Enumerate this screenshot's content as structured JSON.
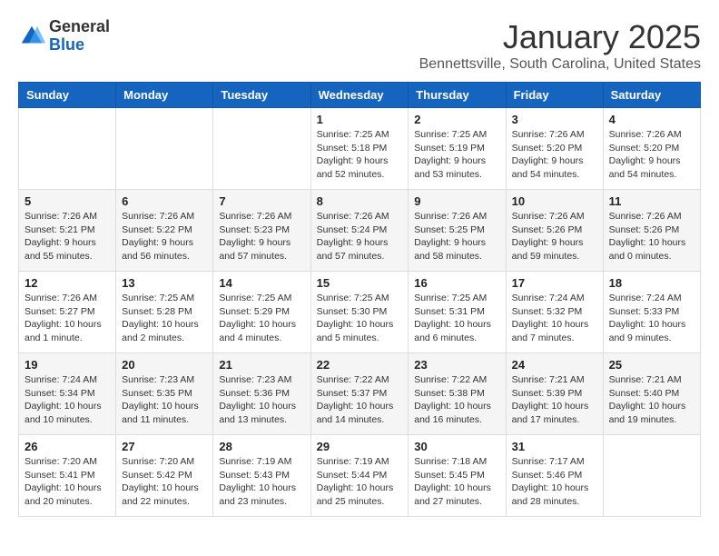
{
  "logo": {
    "general": "General",
    "blue": "Blue"
  },
  "header": {
    "month": "January 2025",
    "location": "Bennettsville, South Carolina, United States"
  },
  "days_of_week": [
    "Sunday",
    "Monday",
    "Tuesday",
    "Wednesday",
    "Thursday",
    "Friday",
    "Saturday"
  ],
  "weeks": [
    [
      {
        "day": "",
        "info": ""
      },
      {
        "day": "",
        "info": ""
      },
      {
        "day": "",
        "info": ""
      },
      {
        "day": "1",
        "info": "Sunrise: 7:25 AM\nSunset: 5:18 PM\nDaylight: 9 hours and 52 minutes."
      },
      {
        "day": "2",
        "info": "Sunrise: 7:25 AM\nSunset: 5:19 PM\nDaylight: 9 hours and 53 minutes."
      },
      {
        "day": "3",
        "info": "Sunrise: 7:26 AM\nSunset: 5:20 PM\nDaylight: 9 hours and 54 minutes."
      },
      {
        "day": "4",
        "info": "Sunrise: 7:26 AM\nSunset: 5:20 PM\nDaylight: 9 hours and 54 minutes."
      }
    ],
    [
      {
        "day": "5",
        "info": "Sunrise: 7:26 AM\nSunset: 5:21 PM\nDaylight: 9 hours and 55 minutes."
      },
      {
        "day": "6",
        "info": "Sunrise: 7:26 AM\nSunset: 5:22 PM\nDaylight: 9 hours and 56 minutes."
      },
      {
        "day": "7",
        "info": "Sunrise: 7:26 AM\nSunset: 5:23 PM\nDaylight: 9 hours and 57 minutes."
      },
      {
        "day": "8",
        "info": "Sunrise: 7:26 AM\nSunset: 5:24 PM\nDaylight: 9 hours and 57 minutes."
      },
      {
        "day": "9",
        "info": "Sunrise: 7:26 AM\nSunset: 5:25 PM\nDaylight: 9 hours and 58 minutes."
      },
      {
        "day": "10",
        "info": "Sunrise: 7:26 AM\nSunset: 5:26 PM\nDaylight: 9 hours and 59 minutes."
      },
      {
        "day": "11",
        "info": "Sunrise: 7:26 AM\nSunset: 5:26 PM\nDaylight: 10 hours and 0 minutes."
      }
    ],
    [
      {
        "day": "12",
        "info": "Sunrise: 7:26 AM\nSunset: 5:27 PM\nDaylight: 10 hours and 1 minute."
      },
      {
        "day": "13",
        "info": "Sunrise: 7:25 AM\nSunset: 5:28 PM\nDaylight: 10 hours and 2 minutes."
      },
      {
        "day": "14",
        "info": "Sunrise: 7:25 AM\nSunset: 5:29 PM\nDaylight: 10 hours and 4 minutes."
      },
      {
        "day": "15",
        "info": "Sunrise: 7:25 AM\nSunset: 5:30 PM\nDaylight: 10 hours and 5 minutes."
      },
      {
        "day": "16",
        "info": "Sunrise: 7:25 AM\nSunset: 5:31 PM\nDaylight: 10 hours and 6 minutes."
      },
      {
        "day": "17",
        "info": "Sunrise: 7:24 AM\nSunset: 5:32 PM\nDaylight: 10 hours and 7 minutes."
      },
      {
        "day": "18",
        "info": "Sunrise: 7:24 AM\nSunset: 5:33 PM\nDaylight: 10 hours and 9 minutes."
      }
    ],
    [
      {
        "day": "19",
        "info": "Sunrise: 7:24 AM\nSunset: 5:34 PM\nDaylight: 10 hours and 10 minutes."
      },
      {
        "day": "20",
        "info": "Sunrise: 7:23 AM\nSunset: 5:35 PM\nDaylight: 10 hours and 11 minutes."
      },
      {
        "day": "21",
        "info": "Sunrise: 7:23 AM\nSunset: 5:36 PM\nDaylight: 10 hours and 13 minutes."
      },
      {
        "day": "22",
        "info": "Sunrise: 7:22 AM\nSunset: 5:37 PM\nDaylight: 10 hours and 14 minutes."
      },
      {
        "day": "23",
        "info": "Sunrise: 7:22 AM\nSunset: 5:38 PM\nDaylight: 10 hours and 16 minutes."
      },
      {
        "day": "24",
        "info": "Sunrise: 7:21 AM\nSunset: 5:39 PM\nDaylight: 10 hours and 17 minutes."
      },
      {
        "day": "25",
        "info": "Sunrise: 7:21 AM\nSunset: 5:40 PM\nDaylight: 10 hours and 19 minutes."
      }
    ],
    [
      {
        "day": "26",
        "info": "Sunrise: 7:20 AM\nSunset: 5:41 PM\nDaylight: 10 hours and 20 minutes."
      },
      {
        "day": "27",
        "info": "Sunrise: 7:20 AM\nSunset: 5:42 PM\nDaylight: 10 hours and 22 minutes."
      },
      {
        "day": "28",
        "info": "Sunrise: 7:19 AM\nSunset: 5:43 PM\nDaylight: 10 hours and 23 minutes."
      },
      {
        "day": "29",
        "info": "Sunrise: 7:19 AM\nSunset: 5:44 PM\nDaylight: 10 hours and 25 minutes."
      },
      {
        "day": "30",
        "info": "Sunrise: 7:18 AM\nSunset: 5:45 PM\nDaylight: 10 hours and 27 minutes."
      },
      {
        "day": "31",
        "info": "Sunrise: 7:17 AM\nSunset: 5:46 PM\nDaylight: 10 hours and 28 minutes."
      },
      {
        "day": "",
        "info": ""
      }
    ]
  ]
}
